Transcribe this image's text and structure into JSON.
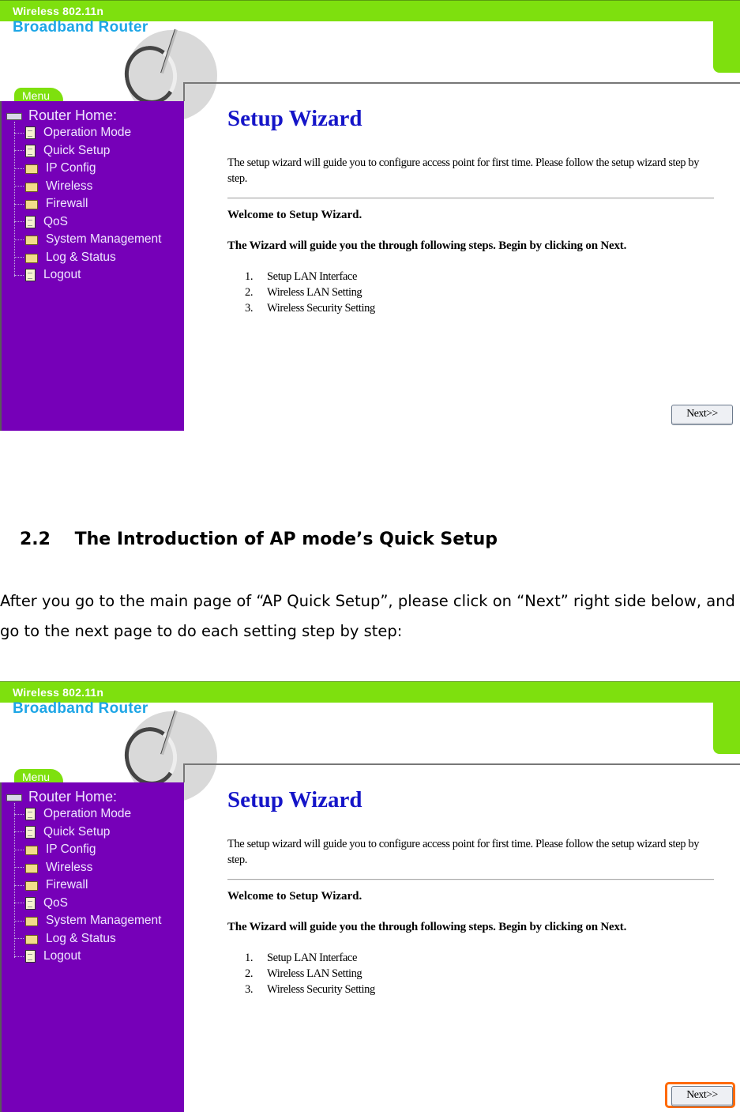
{
  "screenshot_1": {
    "brand": {
      "top_line": "Wireless 802.11n",
      "main_line": "Broadband Router"
    },
    "menu_tab": "Menu",
    "sidebar": {
      "root_label": "Router Home:",
      "items": [
        {
          "label": "Operation Mode",
          "icon": "page-icon"
        },
        {
          "label": "Quick Setup",
          "icon": "page-icon"
        },
        {
          "label": "IP Config",
          "icon": "folder-icon"
        },
        {
          "label": "Wireless",
          "icon": "folder-icon"
        },
        {
          "label": "Firewall",
          "icon": "folder-icon"
        },
        {
          "label": "QoS",
          "icon": "page-icon"
        },
        {
          "label": "System Management",
          "icon": "folder-icon"
        },
        {
          "label": "Log & Status",
          "icon": "folder-icon"
        },
        {
          "label": "Logout",
          "icon": "page-icon"
        }
      ]
    },
    "content": {
      "title": "Setup Wizard",
      "description": "The setup wizard will guide you to configure access point for first time. Please follow the setup wizard step by step.",
      "welcome": "Welcome to Setup Wizard.",
      "guide": "The Wizard will guide you the through following steps. Begin by clicking on Next.",
      "steps": [
        {
          "num": "1.",
          "label": "Setup LAN Interface"
        },
        {
          "num": "2.",
          "label": "Wireless LAN Setting"
        },
        {
          "num": "3.",
          "label": "Wireless Security Setting"
        }
      ],
      "next_button": "Next>>"
    }
  },
  "document": {
    "section_number": "2.2",
    "section_title": "The Introduction of AP mode’s Quick Setup",
    "paragraph": "After you go to the main page of “AP Quick Setup”, please click on “Next” right side below, and go to the next page to do each setting step by step:"
  },
  "screenshot_2": {
    "brand": {
      "top_line": "Wireless 802.11n",
      "main_line": "Broadband Router"
    },
    "menu_tab": "Menu",
    "sidebar": {
      "root_label": "Router Home:",
      "items": [
        {
          "label": "Operation Mode",
          "icon": "page-icon"
        },
        {
          "label": "Quick Setup",
          "icon": "page-icon"
        },
        {
          "label": "IP Config",
          "icon": "folder-icon"
        },
        {
          "label": "Wireless",
          "icon": "folder-icon"
        },
        {
          "label": "Firewall",
          "icon": "folder-icon"
        },
        {
          "label": "QoS",
          "icon": "page-icon"
        },
        {
          "label": "System Management",
          "icon": "folder-icon"
        },
        {
          "label": "Log & Status",
          "icon": "folder-icon"
        },
        {
          "label": "Logout",
          "icon": "page-icon"
        }
      ]
    },
    "content": {
      "title": "Setup Wizard",
      "description": "The setup wizard will guide you to configure access point for first time. Please follow the setup wizard step by step.",
      "welcome": "Welcome to Setup Wizard.",
      "guide": "The Wizard will guide you the through following steps. Begin by clicking on Next.",
      "steps": [
        {
          "num": "1.",
          "label": "Setup LAN Interface"
        },
        {
          "num": "2.",
          "label": "Wireless LAN Setting"
        },
        {
          "num": "3.",
          "label": "Wireless Security Setting"
        }
      ],
      "next_button": "Next>>",
      "next_button_highlighted": true
    }
  },
  "colors": {
    "header_green": "#7ee00e",
    "brand_blue": "#1ea6e6",
    "sidebar_purple": "#7600b8",
    "title_blue": "#1515c8",
    "highlight_orange": "#ff6a00"
  }
}
